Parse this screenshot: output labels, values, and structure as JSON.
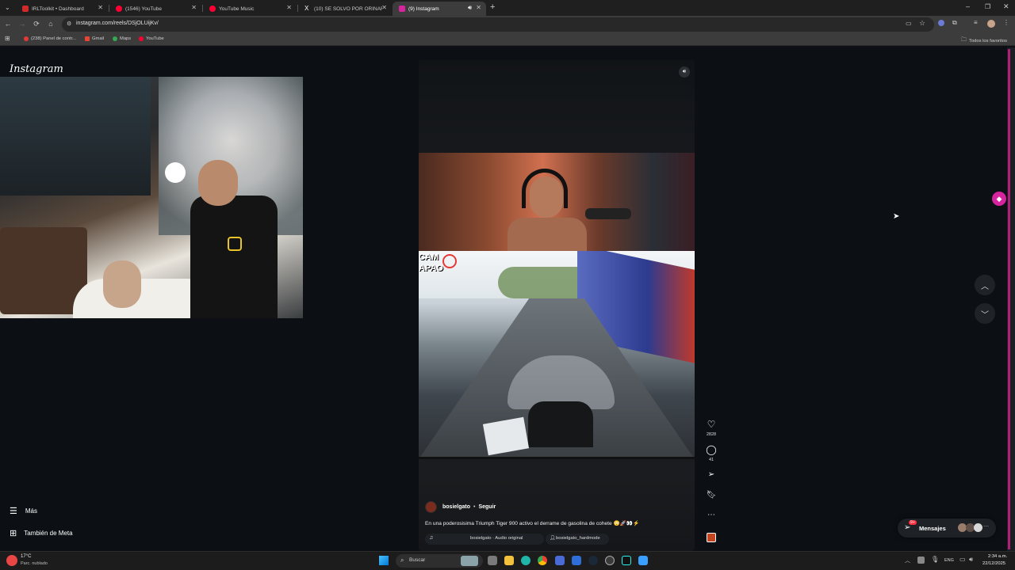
{
  "tabs": [
    {
      "label": "IRLToolkit • Dashboard",
      "color": "#d02a2a"
    },
    {
      "label": "(1546) YouTube",
      "color": "#ff0033"
    },
    {
      "label": "YouTube Music",
      "color": "#ff0033"
    },
    {
      "label": "(10) SE SOLVO POR ORINAR - ",
      "color": "#ffffff"
    },
    {
      "label": "(9) Instagram",
      "color": "#d6249f"
    }
  ],
  "toolbar": {
    "url": "instagram.com/reels/DSjOLUijKv/"
  },
  "bookmarks": {
    "items": [
      {
        "label": "(238) Panel de contr...",
        "color": "#e53935"
      },
      {
        "label": "Gmail",
        "color": "#ea4335"
      },
      {
        "label": "Maps",
        "color": "#34a853"
      },
      {
        "label": "YouTube",
        "color": "#ff0033"
      }
    ],
    "all_favorites": "Todos los favoritos"
  },
  "instagram": {
    "logo": "Instagram",
    "sidebar": {
      "more": "Más",
      "meta": "También de Meta"
    },
    "reel": {
      "overlay_text_1": "CAM",
      "overlay_text_2": "APAO",
      "likes": "2828",
      "comments": "41",
      "username": "bosielgato",
      "follow": "Seguir",
      "dot": "•",
      "caption": "En una poderosisima Triumph Tiger 900 activo el derrame de gasolina de cohete 😳🚀👀⚡",
      "audio": "bosielgato · Audio original",
      "tagged_user": "bosielgato_hardmode"
    },
    "messages": {
      "label": "Mensajes",
      "badge": "9+"
    }
  },
  "taskbar": {
    "weather_temp": "17°C",
    "weather_desc": "Parc. nublado",
    "search_placeholder": "Buscar",
    "lang": "ENG",
    "time": "2:34 a.m.",
    "date": "22/12/2025"
  },
  "colors": {
    "instagram_accent": "#d6249f",
    "page_bg": "#0c1014"
  }
}
